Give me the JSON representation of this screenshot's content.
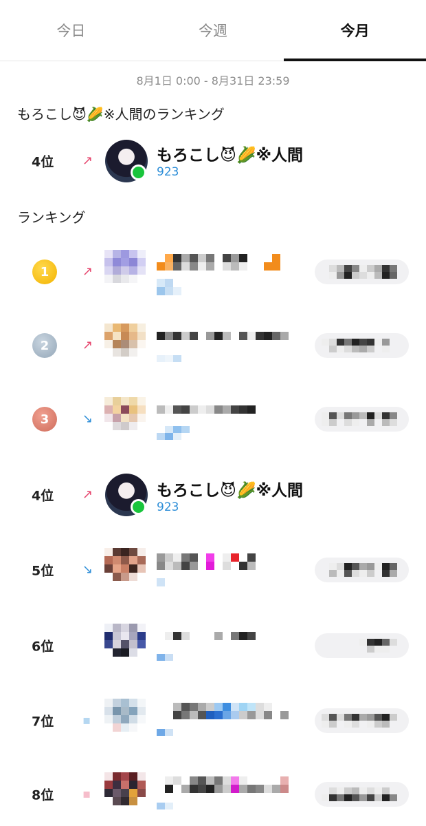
{
  "tabs": [
    {
      "label": "今日",
      "active": false
    },
    {
      "label": "今週",
      "active": false
    },
    {
      "label": "今月",
      "active": true
    }
  ],
  "date_range": "8月1日 0:00 - 8月31日 23:59",
  "my_ranking": {
    "title": "もろこし😈🌽※人間のランキング",
    "rank": "4位",
    "trend": "up",
    "name": "もろこし😈🌽※人間",
    "score": "923",
    "online": true
  },
  "ranking_title": "ランキング",
  "ranking": [
    {
      "rank": "1",
      "medal": "gold",
      "trend": "up",
      "censored": true
    },
    {
      "rank": "2",
      "medal": "silver",
      "trend": "up",
      "censored": true
    },
    {
      "rank": "3",
      "medal": "bronze",
      "trend": "down",
      "censored": true
    },
    {
      "rank": "4位",
      "trend": "up",
      "name": "もろこし😈🌽※人間",
      "score": "923",
      "censored": false
    },
    {
      "rank": "5位",
      "trend": "down",
      "censored": true
    },
    {
      "rank": "6位",
      "trend": "",
      "censored": true
    },
    {
      "rank": "7位",
      "trend": "faint",
      "censored": true
    },
    {
      "rank": "8位",
      "trend": "up-faint",
      "censored": true
    }
  ],
  "colors": {
    "accent_blue": "#2f8fd8",
    "online_green": "#19c53c",
    "trend_up": "#e6456d",
    "trend_down": "#2f8fd8"
  }
}
